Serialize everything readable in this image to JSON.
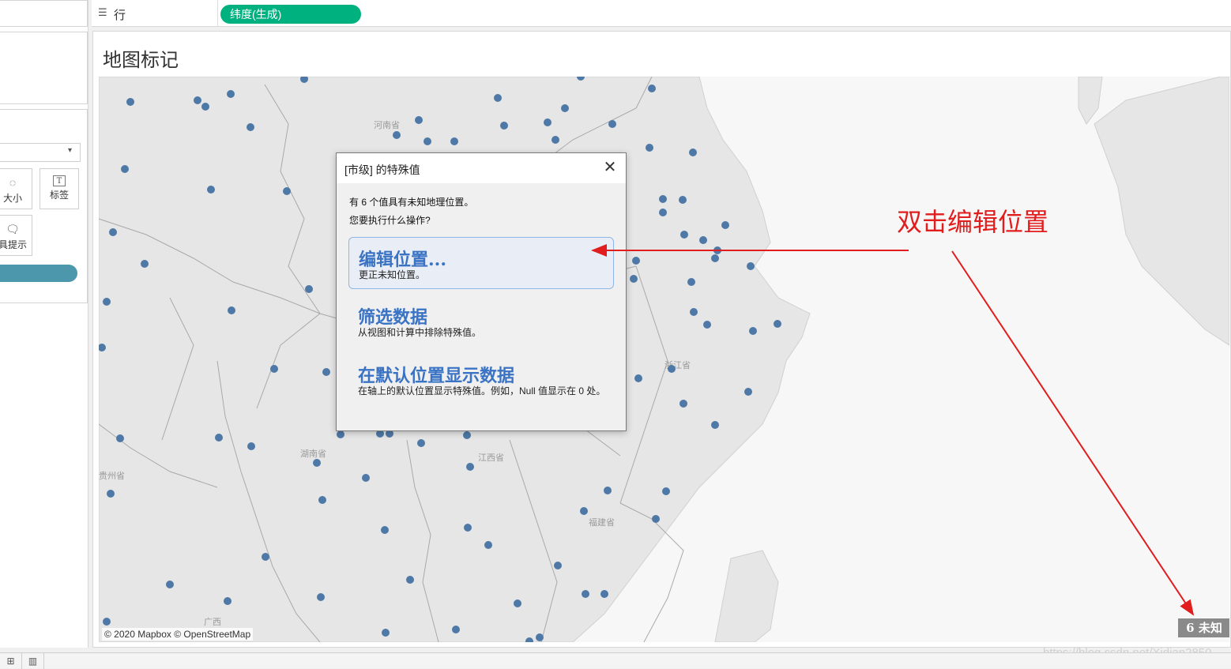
{
  "rows_shelf": {
    "icon": "rows-icon",
    "label": "行",
    "pill": "纬度(生成)"
  },
  "left_panel": {
    "marks": [
      {
        "label": "大小",
        "icon": "size-icon"
      },
      {
        "label": "标签",
        "icon": "label-icon"
      },
      {
        "label": "具提示",
        "icon": "tooltip-icon"
      }
    ]
  },
  "sheet": {
    "title": "地图标记"
  },
  "map": {
    "attribution": "© 2020 Mapbox © OpenStreetMap",
    "unknown_badge": "6 未知",
    "place_labels": [
      "河南省",
      "湖南省",
      "江西省",
      "浙江省",
      "福建省",
      "贵州省",
      "广西"
    ],
    "dot_color": "#4e79a7"
  },
  "dialog": {
    "title": "[市级] 的特殊值",
    "line1": "有 6 个值具有未知地理位置。",
    "line2": "您要执行什么操作?",
    "options": [
      {
        "title": "编辑位置...",
        "desc": "更正未知位置。"
      },
      {
        "title": "筛选数据",
        "desc": "从视图和计算中排除特殊值。"
      },
      {
        "title": "在默认位置显示数据",
        "desc": "在轴上的默认位置显示特殊值。例如，Null 值显示在 0 处。"
      }
    ]
  },
  "annotation": {
    "text": "双击编辑位置",
    "color": "#e11d1d"
  },
  "watermark": "https://blog.csdn.net/Xidian2850"
}
